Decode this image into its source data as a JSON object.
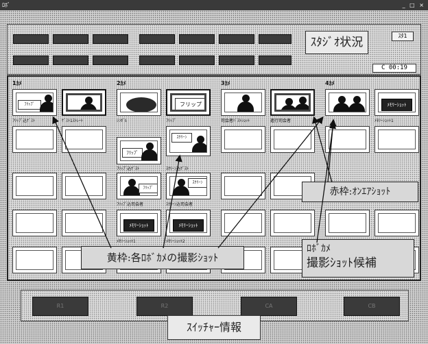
{
  "window": {
    "title": "ﾛﾎﾞ",
    "controls": "_ □ ×"
  },
  "status_panel": {
    "studio_label": "ｽﾀｼﾞｵ状況",
    "studio_badge": "ｽﾀ1",
    "timer": "C 00:19"
  },
  "cameras": [
    {
      "label": "1ｶﾒ"
    },
    {
      "label": "2ｶﾒ"
    },
    {
      "label": "3ｶﾒ"
    },
    {
      "label": "4ｶﾒ"
    }
  ],
  "shots": {
    "c1r1a": {
      "caption": "ﾌﾘｯﾌﾟ込ｹﾞｽﾄ",
      "flip": "ﾌﾘｯﾌﾟ"
    },
    "c1r1b": {
      "caption": "ｹﾞｽﾄ1ｽﾄﾚｰﾄ"
    },
    "c2r1a": {
      "caption": "ｼﾝﾎﾞﾙ"
    },
    "c2r1b": {
      "caption": "ﾌﾘｯﾌﾟ",
      "flip": "フリップ"
    },
    "c2r2b": {
      "caption": "ﾌﾘｯﾌﾟ込ｹﾞｽﾄ",
      "flip": "ﾌﾘｯﾌﾟ"
    },
    "c2r2c": {
      "caption": "ｽｸﾘｰﾝ込ｹﾞｽﾄ",
      "screen": "ｽｸﾘｰﾝ"
    },
    "c2r3a": {
      "caption": "ﾌﾘｯﾌﾟ込司会者",
      "flip": "ﾌﾘｯﾌﾟ"
    },
    "c2r3b": {
      "caption": "ｽｸﾘｰﾝ込司会者",
      "screen": "ｽｸﾘｰﾝ"
    },
    "c2r4a": {
      "caption": "ﾒﾓﾘｰｼｮｯﾄ1",
      "key": "ﾒﾓﾘｰｼｮｯﾄ"
    },
    "c2r4b": {
      "caption": "ﾒﾓﾘｰｼｮｯﾄ2",
      "key": "ﾒﾓﾘｰｼｮｯﾄ"
    },
    "c3r1a": {
      "caption": "司会者ﾊﾞｽﾄｼｮｯﾄ"
    },
    "c3r1b": {
      "caption": "進行司会者"
    },
    "c4r1b": {
      "caption": "ﾒﾓﾘｰｼｮｯﾄ1",
      "key": "ﾒﾓﾘｰｼｮｯﾄ"
    }
  },
  "callouts": {
    "yellow": "黄枠:各ﾛﾎﾞｶﾒの撮影ｼｮｯﾄ",
    "red": "赤枠:ｵﾝｴｱｼｮｯﾄ",
    "robo_line1": "ﾛﾎﾞｶﾒ",
    "robo_line2": "撮影ｼｮｯﾄ候補"
  },
  "switcher": {
    "buttons": [
      "R1",
      "R2",
      "CA",
      "CB"
    ],
    "label": "ｽｲｯﾁｬｰ情報"
  }
}
